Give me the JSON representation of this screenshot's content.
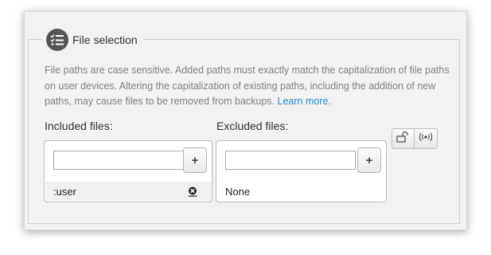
{
  "section": {
    "title": "File selection",
    "icon": "list-check-icon",
    "description": "File paths are case sensitive. Added paths must exactly match the capitalization of file paths on user devices. Altering the capitalization of existing paths, including the addition of new paths, may cause files to be removed from backups.",
    "learn_more": "Learn more."
  },
  "included": {
    "label": "Included files:",
    "input_value": "",
    "add_label": "+",
    "items": [
      ":user"
    ]
  },
  "excluded": {
    "label": "Excluded files:",
    "input_value": "",
    "add_label": "+",
    "items": [
      "None"
    ]
  },
  "toolbar": {
    "lock_icon": "unlock-icon",
    "broadcast_icon": "broadcast-icon"
  },
  "colors": {
    "link": "#1a8fd6",
    "panel_bg": "#f2f2f2"
  }
}
